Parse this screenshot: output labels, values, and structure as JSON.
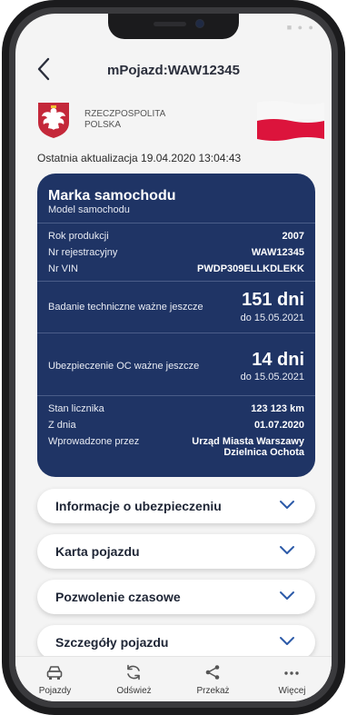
{
  "header": {
    "title": "mPojazd:WAW12345",
    "back_icon": "chevron-left-icon"
  },
  "issuer": {
    "name_line1": "RZECZPOSPOLITA",
    "name_line2": "POLSKA",
    "emblem_icon": "polish-eagle-emblem",
    "flag_icon": "polish-flag"
  },
  "last_update": "Ostatnia aktualizacja 19.04.2020 13:04:43",
  "vehicle": {
    "make": "Marka samochodu",
    "model": "Model samochodu",
    "details": [
      {
        "label": "Rok produkcji",
        "value": "2007"
      },
      {
        "label": "Nr rejestracyjny",
        "value": "WAW12345"
      },
      {
        "label": "Nr VIN",
        "value": "PWDP309ELLKDLEKK"
      }
    ],
    "inspection": {
      "label": "Badanie techniczne ważne jeszcze",
      "days": "151 dni",
      "until": "do 15.05.2021"
    },
    "insurance": {
      "label": "Ubezpieczenie OC ważne jeszcze",
      "days": "14 dni",
      "until": "do 15.05.2021"
    },
    "odometer": {
      "label": "Stan licznika",
      "value": "123 123 km",
      "date_label": "Z dnia",
      "date_value": "01.07.2020",
      "entered_by_label": "Wprowadzone przez",
      "entered_by_line1": "Urząd Miasta Warszawy",
      "entered_by_line2": "Dzielnica Ochota"
    }
  },
  "accordion": [
    {
      "label": "Informacje o ubezpieczeniu"
    },
    {
      "label": "Karta pojazdu"
    },
    {
      "label": "Pozwolenie czasowe"
    },
    {
      "label": "Szczegóły pojazdu"
    }
  ],
  "tabbar": [
    {
      "label": "Pojazdy",
      "icon": "car-icon"
    },
    {
      "label": "Odśwież",
      "icon": "refresh-icon"
    },
    {
      "label": "Przekaż",
      "icon": "share-icon"
    },
    {
      "label": "Więcej",
      "icon": "more-icon"
    }
  ],
  "colors": {
    "card_bg": "#1f3465",
    "flag_red": "#dc143c",
    "accent_chevron": "#2c5aa8"
  }
}
